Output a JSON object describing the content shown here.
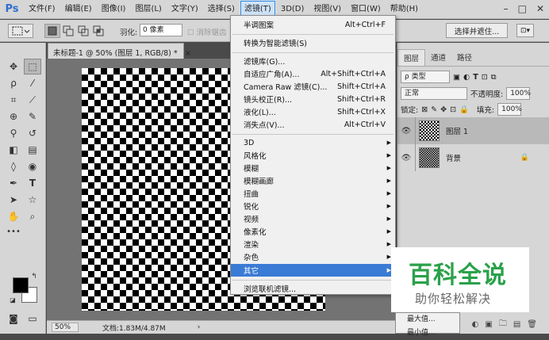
{
  "app": {
    "logo": "Ps"
  },
  "menubar": {
    "items": [
      "文件(F)",
      "编辑(E)",
      "图像(I)",
      "图层(L)",
      "文字(Y)",
      "选择(S)",
      "滤镜(T)",
      "3D(D)",
      "视图(V)",
      "窗口(W)",
      "帮助(H)"
    ],
    "active_index": 6,
    "window_buttons": [
      "–",
      "□",
      "✕"
    ]
  },
  "optionsbar": {
    "feather_label": "羽化:",
    "feather_value": "0 像素",
    "antialias_label": "消除锯齿",
    "select_refine_label": "选择并遮住...",
    "workspace_icon": "⊡▾"
  },
  "document": {
    "tab_title": "未标题-1 @ 50% (图层 1, RGB/8) *",
    "tab_close": "×",
    "zoom": "50%",
    "doc_info": "文档:1.83M/4.87M",
    "status_arrow": "›"
  },
  "filter_menu": {
    "items": [
      {
        "label": "半调图案",
        "shortcut": "Alt+Ctrl+F"
      },
      {
        "label": "转换为智能滤镜(S)"
      },
      {
        "label": "滤镜库(G)..."
      },
      {
        "label": "自适应广角(A)...",
        "shortcut": "Alt+Shift+Ctrl+A"
      },
      {
        "label": "Camera Raw 滤镜(C)...",
        "shortcut": "Shift+Ctrl+A"
      },
      {
        "label": "镜头校正(R)...",
        "shortcut": "Shift+Ctrl+R"
      },
      {
        "label": "液化(L)...",
        "shortcut": "Shift+Ctrl+X"
      },
      {
        "label": "消失点(V)...",
        "shortcut": "Alt+Ctrl+V"
      },
      {
        "label": "3D",
        "submenu": true
      },
      {
        "label": "风格化",
        "submenu": true
      },
      {
        "label": "模糊",
        "submenu": true
      },
      {
        "label": "模糊画廊",
        "submenu": true
      },
      {
        "label": "扭曲",
        "submenu": true
      },
      {
        "label": "锐化",
        "submenu": true
      },
      {
        "label": "视频",
        "submenu": true
      },
      {
        "label": "像素化",
        "submenu": true
      },
      {
        "label": "渲染",
        "submenu": true
      },
      {
        "label": "杂色",
        "submenu": true
      },
      {
        "label": "其它",
        "submenu": true,
        "highlighted": true
      },
      {
        "label": "浏览联机滤镜..."
      }
    ]
  },
  "submenu": {
    "items": [
      "最大值...",
      "最小值..."
    ]
  },
  "panel": {
    "tabs": [
      "图层",
      "通道",
      "路径"
    ],
    "active_tab": 0,
    "kind_label": "ρ 类型",
    "blend_mode": "正常",
    "opacity_label": "不透明度:",
    "opacity_value": "100%",
    "lock_label": "锁定:",
    "fill_label": "填充:",
    "fill_value": "100%",
    "layers": [
      {
        "name": "图层 1",
        "selected": true,
        "locked": false
      },
      {
        "name": "背景",
        "selected": false,
        "locked": true
      }
    ],
    "lock_icon": "🔒",
    "footer_icons": [
      "◐",
      "▣",
      "🗀",
      "▤",
      "🗑"
    ]
  },
  "watermark": {
    "title": "百科全说",
    "subtitle": "助你轻松解决"
  },
  "colors": {
    "menu_highlight": "#3a7bd5",
    "watermark_green": "#2aa14a"
  }
}
